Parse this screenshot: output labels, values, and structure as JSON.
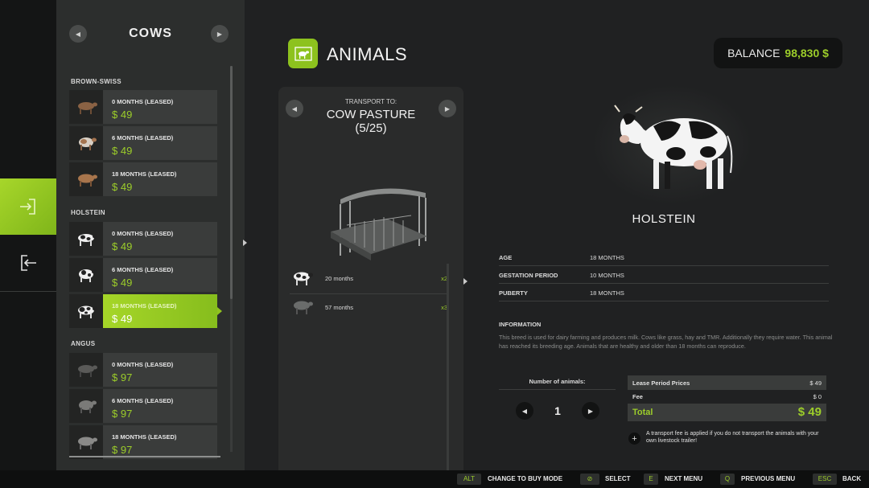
{
  "rail": {
    "enter_icon": "enter-icon",
    "exit_icon": "exit-icon"
  },
  "list": {
    "title": "COWS",
    "groups": [
      {
        "breed": "BROWN-SWISS",
        "items": [
          {
            "label": "0 MONTHS (LEASED)",
            "price": "$ 49"
          },
          {
            "label": "6 MONTHS (LEASED)",
            "price": "$ 49"
          },
          {
            "label": "18 MONTHS (LEASED)",
            "price": "$ 49"
          }
        ]
      },
      {
        "breed": "HOLSTEIN",
        "items": [
          {
            "label": "0 MONTHS (LEASED)",
            "price": "$ 49"
          },
          {
            "label": "6 MONTHS (LEASED)",
            "price": "$ 49"
          },
          {
            "label": "18 MONTHS (LEASED)",
            "price": "$ 49",
            "selected": true
          }
        ]
      },
      {
        "breed": "ANGUS",
        "items": [
          {
            "label": "0 MONTHS (LEASED)",
            "price": "$ 97"
          },
          {
            "label": "6 MONTHS (LEASED)",
            "price": "$ 97"
          },
          {
            "label": "18 MONTHS (LEASED)",
            "price": "$ 97"
          }
        ]
      }
    ]
  },
  "header": {
    "title": "ANIMALS",
    "balance_label": "BALANCE",
    "balance_value": "98,830 $"
  },
  "transport": {
    "label": "TRANSPORT TO:",
    "destination": "COW PASTURE",
    "capacity": "(5/25)",
    "animals": [
      {
        "age": "20 months",
        "count": "x2"
      },
      {
        "age": "57 months",
        "count": "x3"
      }
    ]
  },
  "detail": {
    "breed": "HOLSTEIN",
    "attributes": [
      {
        "key": "AGE",
        "value": "18 MONTHS"
      },
      {
        "key": "GESTATION PERIOD",
        "value": "10 MONTHS"
      },
      {
        "key": "PUBERTY",
        "value": "18 MONTHS"
      }
    ],
    "info_title": "INFORMATION",
    "info_text": "This breed is used for dairy farming and produces milk. Cows like grass, hay and TMR. Additionally they require water. This animal has reached its breeding age. Animals that are healthy and older than 18 months can reproduce.",
    "number_label": "Number of animals:",
    "number_value": "1",
    "prices": {
      "lease_label": "Lease Period Prices",
      "lease_value": "$ 49",
      "fee_label": "Fee",
      "fee_value": "$ 0",
      "total_label": "Total",
      "total_value": "$ 49"
    },
    "note": "A transport fee is applied if you do not transport the animals with your own livestock trailer!"
  },
  "footer": [
    {
      "key": "ALT",
      "label": "CHANGE TO BUY MODE"
    },
    {
      "key": "⊘",
      "label": "SELECT"
    },
    {
      "key": "E",
      "label": "NEXT MENU"
    },
    {
      "key": "Q",
      "label": "PREVIOUS MENU"
    },
    {
      "key": "ESC",
      "label": "BACK"
    }
  ],
  "colors": {
    "accent": "#9ccd2a",
    "panel": "#2c2e2d",
    "background": "#202122"
  }
}
